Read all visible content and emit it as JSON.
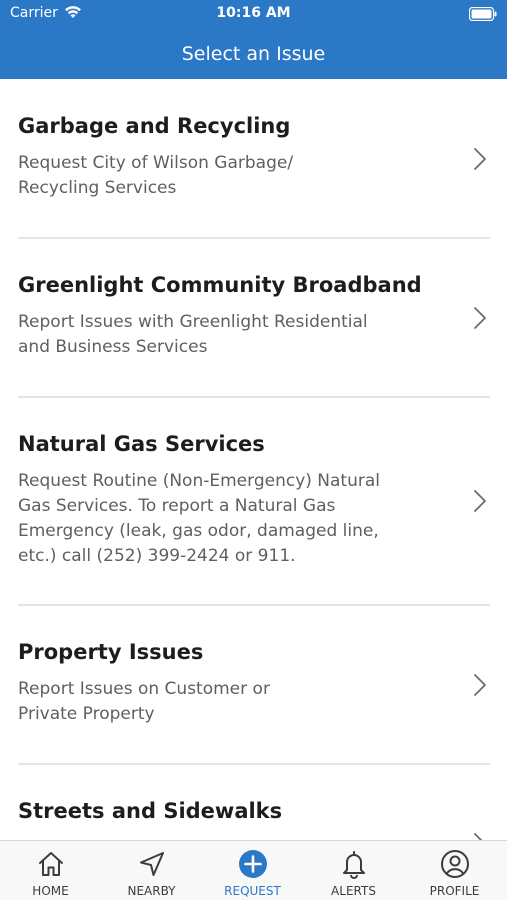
{
  "status_bar": {
    "carrier": "Carrier",
    "time": "10:16 AM"
  },
  "nav": {
    "title": "Select an Issue"
  },
  "issues": [
    {
      "title": "Garbage and Recycling",
      "description": "Request City of Wilson Garbage/ Recycling Services"
    },
    {
      "title": "Greenlight Community Broadband",
      "description": "Report Issues with Greenlight Residential and Business Services"
    },
    {
      "title": "Natural Gas Services",
      "description": "Request Routine (Non-Emergency) Natural Gas Services. To report a Natural Gas Emergency (leak, gas odor, damaged line, etc.) call (252) 399-2424 or 911."
    },
    {
      "title": "Property Issues",
      "description": "Report Issues on Customer or Private Property"
    },
    {
      "title": "Streets and Sidewalks",
      "description": ""
    }
  ],
  "tabs": [
    {
      "label": "HOME",
      "icon": "home-icon"
    },
    {
      "label": "NEARBY",
      "icon": "location-arrow-icon"
    },
    {
      "label": "REQUEST",
      "icon": "plus-circle-icon",
      "active": true
    },
    {
      "label": "ALERTS",
      "icon": "bell-icon"
    },
    {
      "label": "PROFILE",
      "icon": "user-icon"
    }
  ],
  "colors": {
    "brand_blue": "#2b78c6",
    "title_text": "#1d1d1d",
    "description_text": "#5f5f5f",
    "divider": "#e4e4e4",
    "tab_inactive": "#3c3c3c"
  }
}
